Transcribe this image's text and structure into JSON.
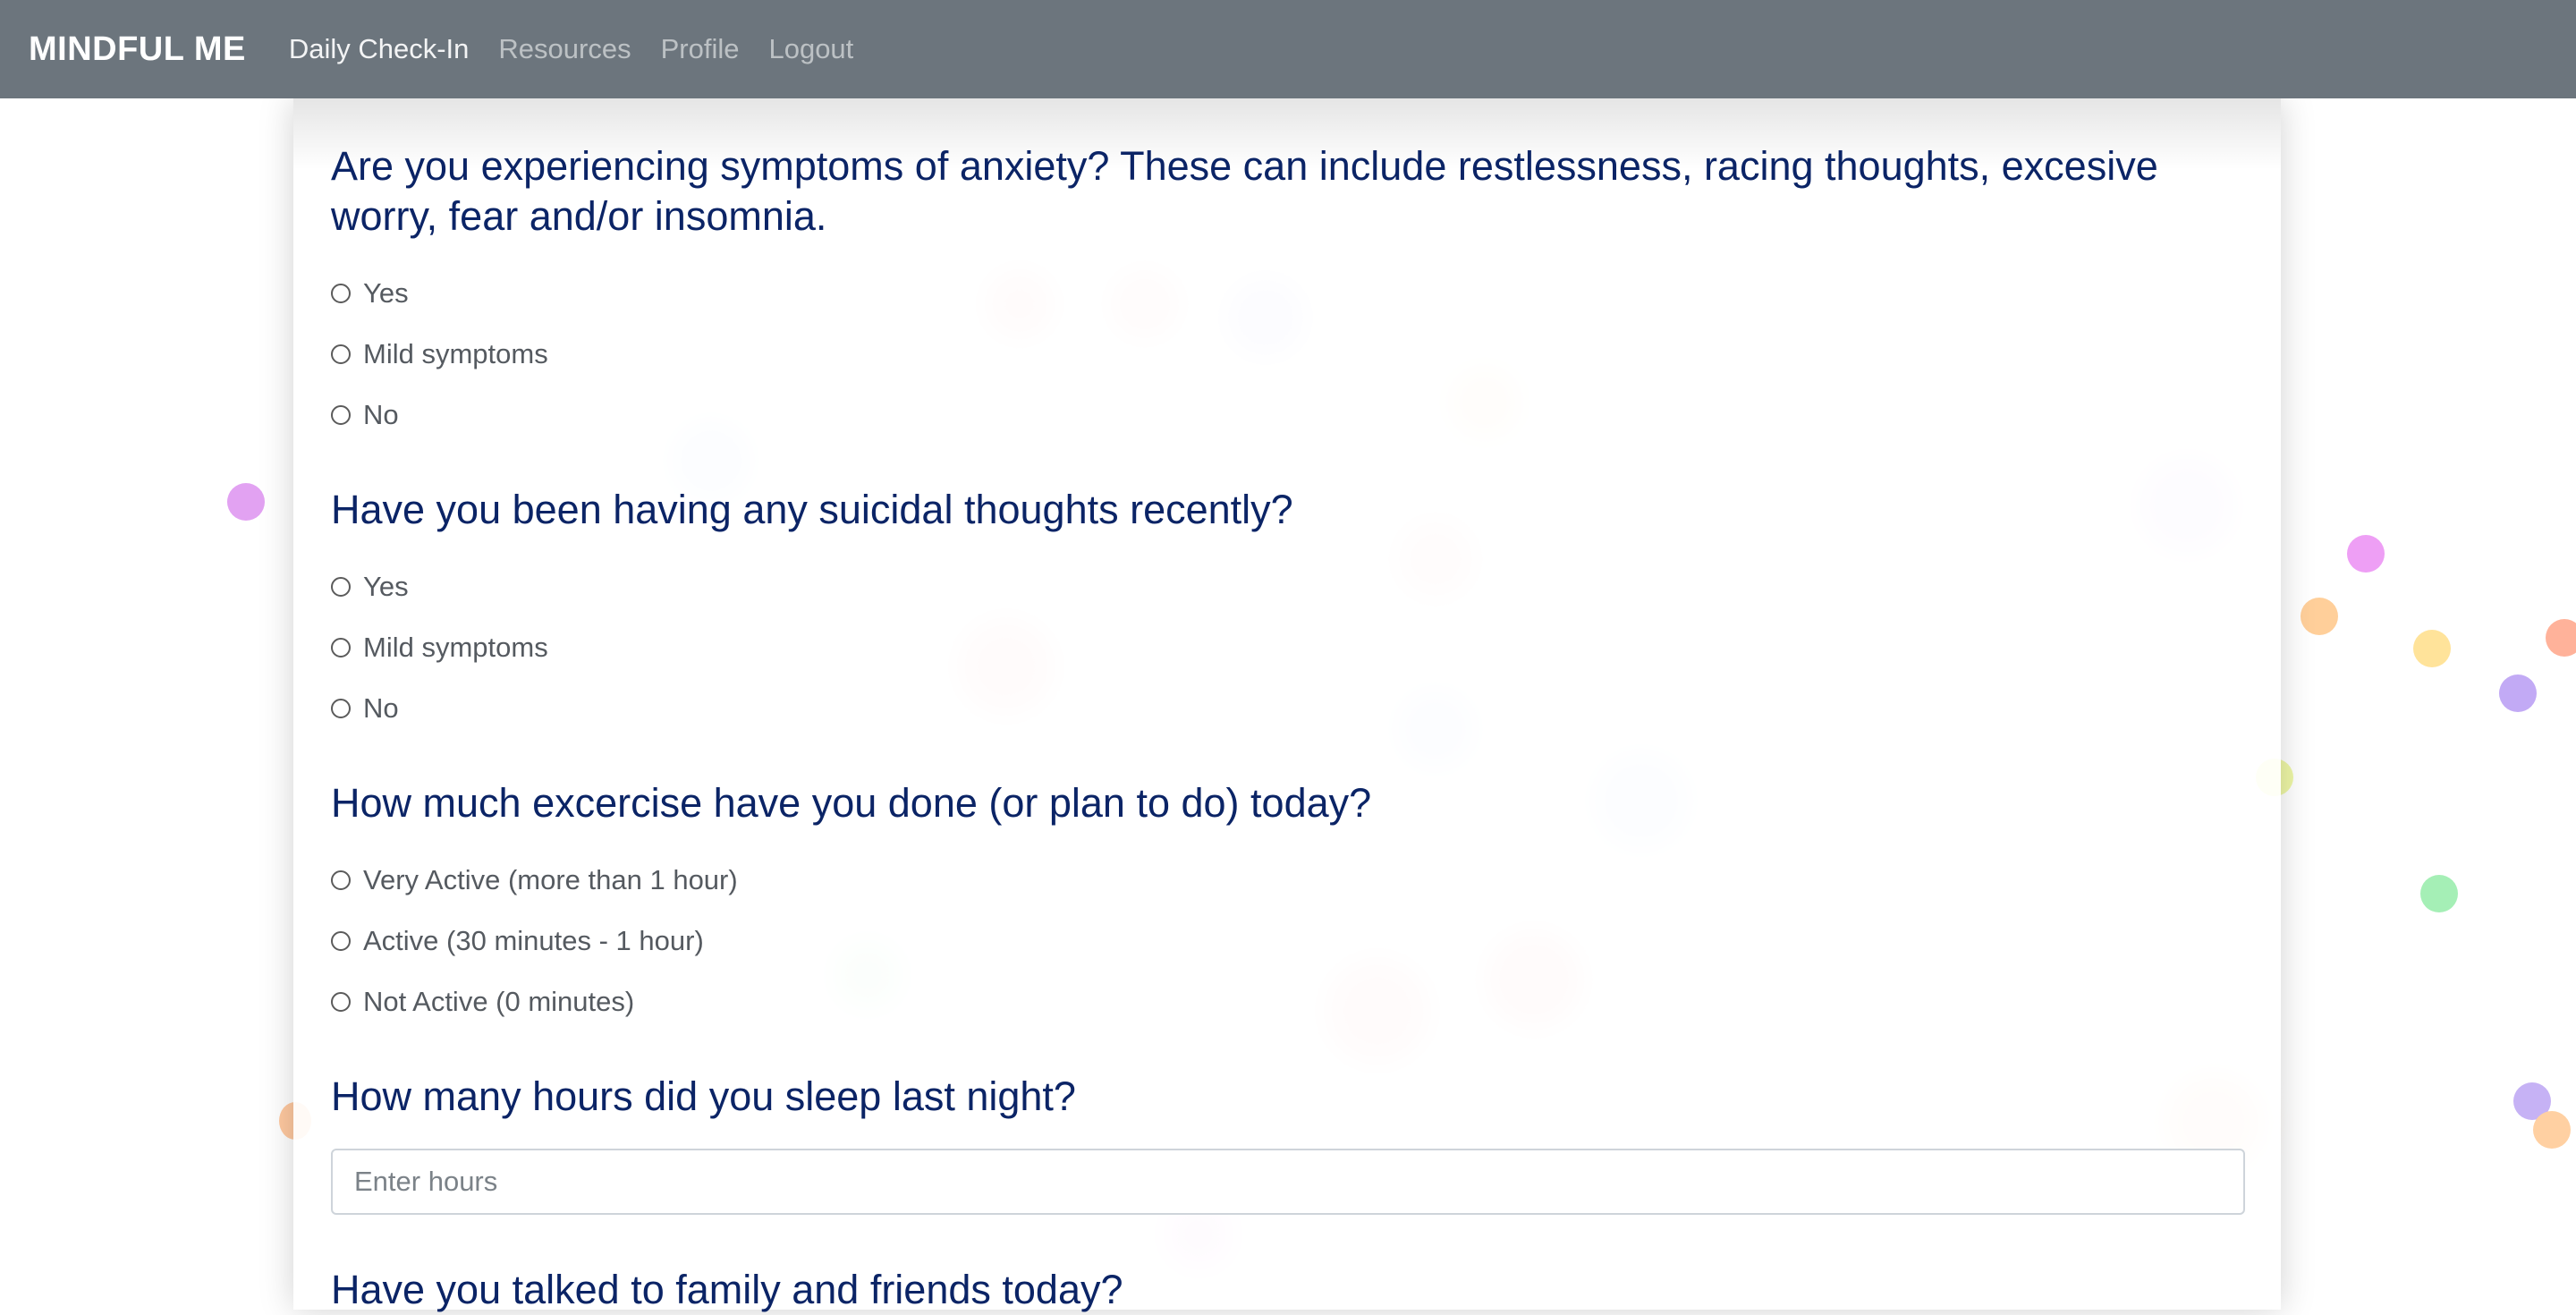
{
  "navbar": {
    "brand": "MINDFUL ME",
    "links": [
      {
        "label": "Daily Check-In",
        "active": true
      },
      {
        "label": "Resources",
        "active": false
      },
      {
        "label": "Profile",
        "active": false
      },
      {
        "label": "Logout",
        "active": false
      }
    ]
  },
  "questions": [
    {
      "text": "Are you experiencing symptoms of anxiety? These can include restlessness, racing thoughts, excesive worry, fear and/or insomnia.",
      "options": [
        "Yes",
        "Mild symptoms",
        "No"
      ]
    },
    {
      "text": "Have you been having any suicidal thoughts recently?",
      "options": [
        "Yes",
        "Mild symptoms",
        "No"
      ]
    },
    {
      "text": "How much excercise have you done (or plan to do) today?",
      "options": [
        "Very Active (more than 1 hour)",
        "Active (30 minutes - 1 hour)",
        "Not Active (0 minutes)"
      ]
    },
    {
      "text": "How many hours did you sleep last night?",
      "input_placeholder": "Enter hours"
    },
    {
      "text": "Have you talked to family and friends today?"
    }
  ],
  "colors": {
    "navbar_bg": "#6c757d",
    "question_text": "#0b2466",
    "confetti": [
      "#e58cf5",
      "#ffc98a",
      "#ffe08a",
      "#ffa88a",
      "#b9a2f5",
      "#9ff0b0",
      "#eaf5a0"
    ]
  }
}
